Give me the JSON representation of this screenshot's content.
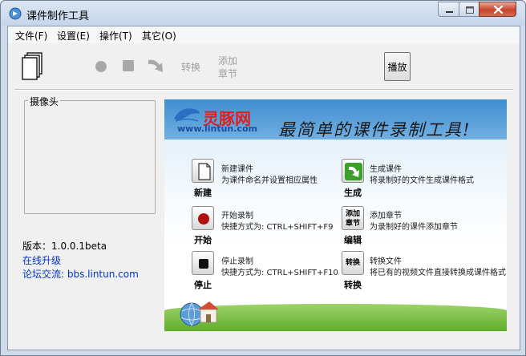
{
  "window": {
    "title": "课件制作工具"
  },
  "menu": [
    "文件(F)",
    "设置(E)",
    "操作(T)",
    "其它(O)"
  ],
  "toolbar": {
    "convert_label": "转换",
    "add_chapter_label": [
      "添加",
      "章节"
    ],
    "play_label": "播放"
  },
  "camera": {
    "group_title": "摄像头"
  },
  "info": {
    "version": "版本：1.0.0.1beta",
    "online_upgrade": "在线升级",
    "forum": "论坛交流: bbs.lintun.com"
  },
  "banner": {
    "logo_text": "灵豚网",
    "logo_url": "www.lintun.com",
    "slogan": "最简单的课件录制工具!",
    "features": [
      {
        "label": "新建",
        "title": "新建课件",
        "desc": "为课件命名并设置相应属性"
      },
      {
        "label": "生成",
        "title": "生成课件",
        "desc": "将录制好的文件生成课件格式"
      },
      {
        "label": "开始",
        "title": "开始录制",
        "desc": "快捷方式为: CTRL+SHIFT+F9"
      },
      {
        "label": "编辑",
        "icon_text": [
          "添加",
          "章节"
        ],
        "title": "添加章节",
        "desc": "为录制好的课件添加章节"
      },
      {
        "label": "停止",
        "title": "停止录制",
        "desc": "快捷方式为: CTRL+SHIFT+F10"
      },
      {
        "label": "转换",
        "icon_text": "转换",
        "title": "转换文件",
        "desc": "将已有的视频文件直接转换成课件格式"
      }
    ]
  },
  "colors": {
    "accent": "#0033cc",
    "close": "#c7442b",
    "record": "#b01010",
    "convert": "#3aa02a"
  }
}
